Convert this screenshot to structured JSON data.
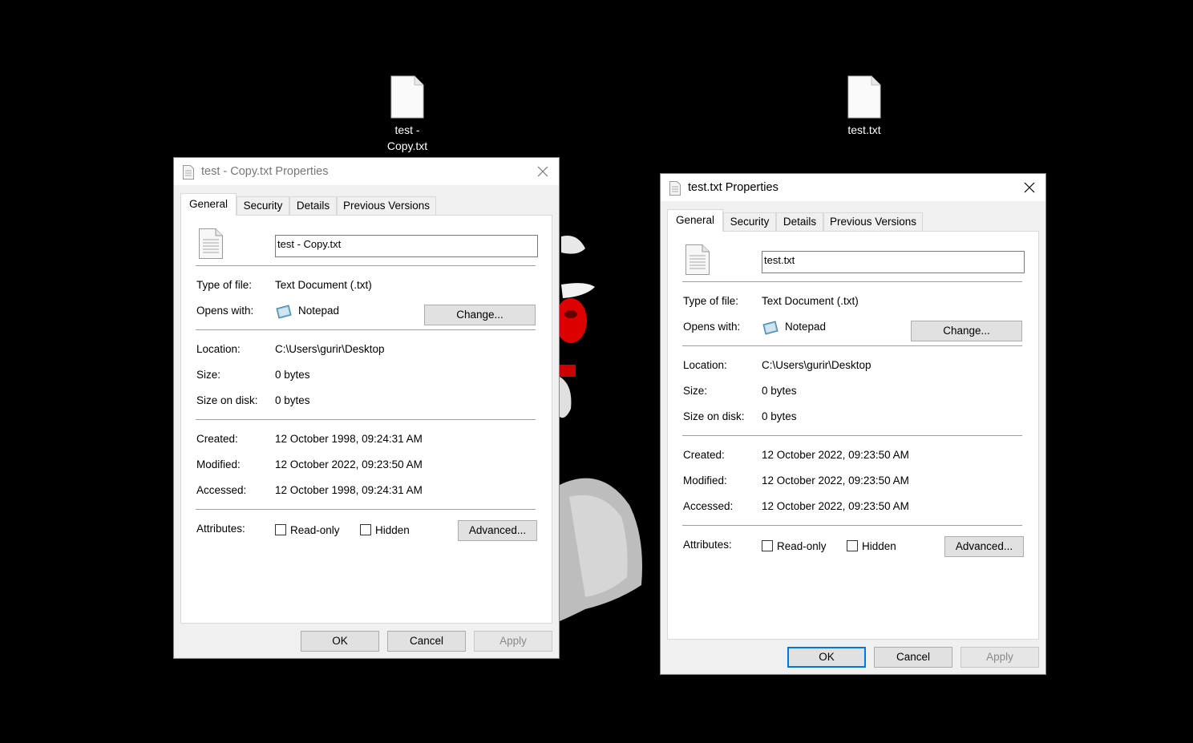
{
  "desktop": {
    "icons": [
      {
        "label": "test - Copy.txt"
      },
      {
        "label": "test.txt"
      }
    ]
  },
  "dialogs": [
    {
      "title": "test - Copy.txt Properties",
      "active": false,
      "tabs": [
        "General",
        "Security",
        "Details",
        "Previous Versions"
      ],
      "file_name": "test - Copy.txt",
      "type_label": "Type of file:",
      "type_value": "Text Document (.txt)",
      "opens_label": "Opens with:",
      "opens_value": "Notepad",
      "change_label": "Change...",
      "location_label": "Location:",
      "location_value": "C:\\Users\\gurir\\Desktop",
      "size_label": "Size:",
      "size_value": "0 bytes",
      "sod_label": "Size on disk:",
      "sod_value": "0 bytes",
      "created_label": "Created:",
      "created_value": "12 October 1998, 09:24:31 AM",
      "modified_label": "Modified:",
      "modified_value": "12 October 2022, 09:23:50 AM",
      "accessed_label": "Accessed:",
      "accessed_value": "12 October 1998, 09:24:31 AM",
      "attributes_label": "Attributes:",
      "readonly_label": "Read-only",
      "hidden_label": "Hidden",
      "advanced_label": "Advanced...",
      "ok_label": "OK",
      "cancel_label": "Cancel",
      "apply_label": "Apply"
    },
    {
      "title": "test.txt Properties",
      "active": true,
      "tabs": [
        "General",
        "Security",
        "Details",
        "Previous Versions"
      ],
      "file_name": "test.txt",
      "type_label": "Type of file:",
      "type_value": "Text Document (.txt)",
      "opens_label": "Opens with:",
      "opens_value": "Notepad",
      "change_label": "Change...",
      "location_label": "Location:",
      "location_value": "C:\\Users\\gurir\\Desktop",
      "size_label": "Size:",
      "size_value": "0 bytes",
      "sod_label": "Size on disk:",
      "sod_value": "0 bytes",
      "created_label": "Created:",
      "created_value": "12 October 2022, 09:23:50 AM",
      "modified_label": "Modified:",
      "modified_value": "12 October 2022, 09:23:50 AM",
      "accessed_label": "Accessed:",
      "accessed_value": "12 October 2022, 09:23:50 AM",
      "attributes_label": "Attributes:",
      "readonly_label": "Read-only",
      "hidden_label": "Hidden",
      "advanced_label": "Advanced...",
      "ok_label": "OK",
      "cancel_label": "Cancel",
      "apply_label": "Apply"
    }
  ]
}
